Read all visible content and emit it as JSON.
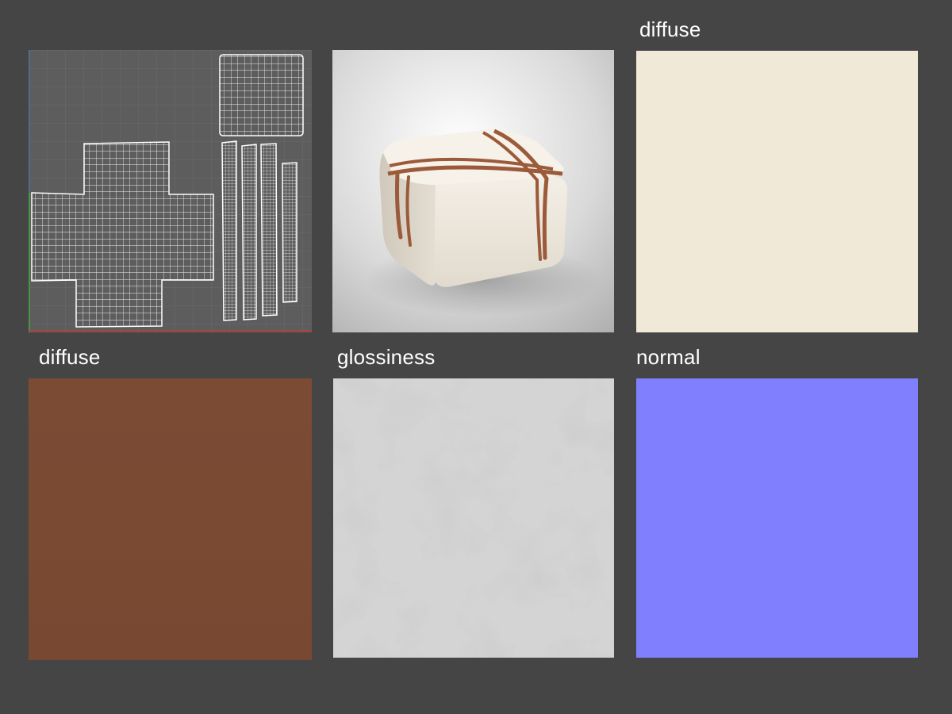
{
  "labels": {
    "diffuse_top": "diffuse",
    "diffuse_bottom": "diffuse",
    "glossiness": "glossiness",
    "normal": "normal"
  },
  "colors": {
    "background": "#464545",
    "uv_background": "#5d5d5d",
    "cream_diffuse": "#f1e9d8",
    "brown_diffuse": "#7a4a34",
    "glossiness_base": "#d4d4d4",
    "normal_map": "#8080fe",
    "ribbon": "#9b5a3a",
    "label_text": "#ffffff"
  },
  "panels": [
    {
      "id": "uv-layout",
      "content": "uv-wireframe"
    },
    {
      "id": "render",
      "content": "gift-box-render"
    },
    {
      "id": "diffuse-cream",
      "content": "texture-swatch"
    },
    {
      "id": "diffuse-brown",
      "content": "texture-swatch"
    },
    {
      "id": "glossiness-map",
      "content": "texture-swatch"
    },
    {
      "id": "normal-map",
      "content": "texture-swatch"
    }
  ]
}
